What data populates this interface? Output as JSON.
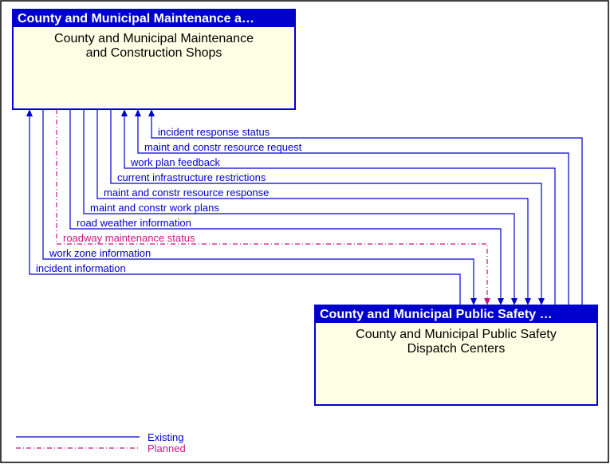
{
  "box1": {
    "header": "County and Municipal Maintenance a…",
    "line1": "County and Municipal Maintenance",
    "line2": "and Construction Shops"
  },
  "box2": {
    "header": "County and Municipal Public Safety …",
    "line1": "County and Municipal Public Safety",
    "line2": "Dispatch Centers"
  },
  "flows": [
    {
      "label": "incident response status",
      "dir": "to1",
      "style": "existing"
    },
    {
      "label": "maint and constr resource request",
      "dir": "to1",
      "style": "existing"
    },
    {
      "label": "work plan feedback",
      "dir": "to1",
      "style": "existing"
    },
    {
      "label": "current infrastructure restrictions",
      "dir": "to2",
      "style": "existing"
    },
    {
      "label": "maint and constr resource response",
      "dir": "to2",
      "style": "existing"
    },
    {
      "label": "maint and constr work plans",
      "dir": "to2",
      "style": "existing"
    },
    {
      "label": "road weather information",
      "dir": "to2",
      "style": "existing"
    },
    {
      "label": "roadway maintenance status",
      "dir": "to2",
      "style": "planned"
    },
    {
      "label": "work zone information",
      "dir": "to2",
      "style": "existing"
    },
    {
      "label": "incident information",
      "dir": "to1",
      "style": "existing"
    }
  ],
  "legend": {
    "existing": "Existing",
    "planned": "Planned"
  }
}
